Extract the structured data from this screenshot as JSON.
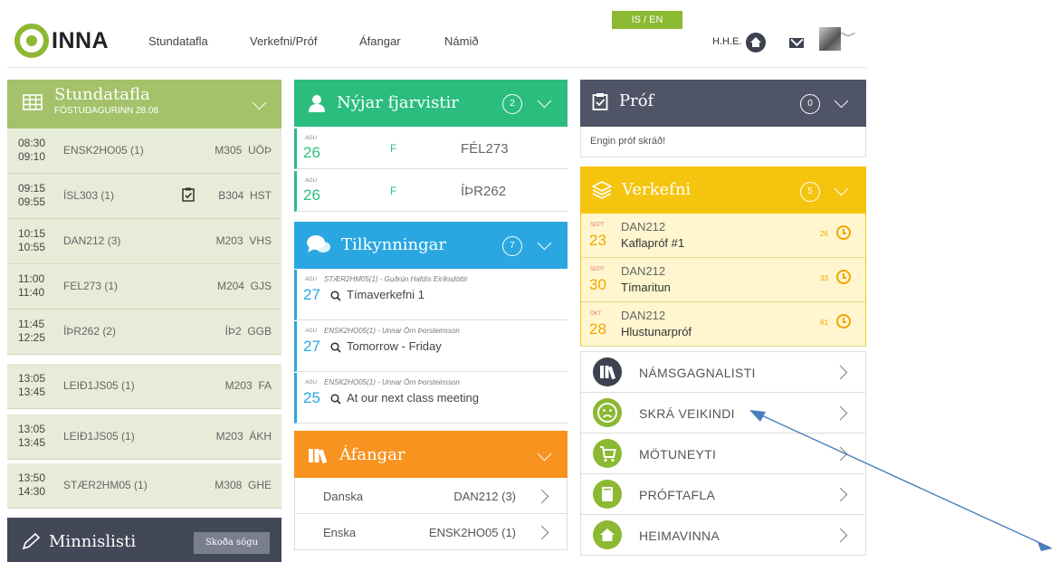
{
  "brand": {
    "logo_text": "INNA",
    "accent": "#8cb832"
  },
  "nav": {
    "items": [
      "Stundatafla",
      "Verkefni/Próf",
      "Áfangar",
      "Námið"
    ]
  },
  "header": {
    "language_toggle": "IS / EN",
    "user_initials": "H.H.E."
  },
  "schedule": {
    "title": "Stundatafla",
    "subtitle": "FÖSTUDAGURINN 28.08",
    "rows": [
      {
        "start": "08:30",
        "end": "09:10",
        "course": "ENSK2HO05 (1)",
        "room": "M305",
        "teacher": "UÖÞ"
      },
      {
        "start": "09:15",
        "end": "09:55",
        "course": "ÍSL303 (1)",
        "room": "B304",
        "teacher": "HST"
      },
      {
        "start": "10:15",
        "end": "10:55",
        "course": "DAN212 (3)",
        "room": "M203",
        "teacher": "VHS"
      },
      {
        "start": "11:00",
        "end": "11:40",
        "course": "FEL273 (1)",
        "room": "M204",
        "teacher": "GJS"
      },
      {
        "start": "11:45",
        "end": "12:25",
        "course": "ÍÞR262 (2)",
        "room": "ÍÞ2",
        "teacher": "GGB"
      },
      {
        "start": "13:05",
        "end": "13:45",
        "course": "LEIÐ1JS05 (1)",
        "room": "M203",
        "teacher": "FA"
      },
      {
        "start": "13:05",
        "end": "13:45",
        "course": "LEIÐ1JS05 (1)",
        "room": "M203",
        "teacher": "ÁKH"
      },
      {
        "start": "13:50",
        "end": "14:30",
        "course": "STÆR2HM05 (1)",
        "room": "M308",
        "teacher": "GHE"
      }
    ]
  },
  "memo": {
    "title": "Minnislisti",
    "history_button": "Skoða sögu"
  },
  "absences": {
    "title": "Nýjar fjarvistir",
    "count": "2",
    "rows": [
      {
        "month": "AGU",
        "day": "26",
        "type": "F",
        "course": "FÉL273"
      },
      {
        "month": "AGU",
        "day": "26",
        "type": "F",
        "course": "ÍÞR262"
      }
    ]
  },
  "announcements": {
    "title": "Tilkynningar",
    "count": "7",
    "rows": [
      {
        "month": "AGU",
        "day": "27",
        "meta": "STÆR2HM05(1) - Guðrún Hafdís Eiríksdóttir",
        "title": "Tímaverkefni 1"
      },
      {
        "month": "AGU",
        "day": "27",
        "meta": "ENSK2HO05(1) - Unnar Örn Þorsteinsson",
        "title": "Tomorrow - Friday"
      },
      {
        "month": "AGU",
        "day": "25",
        "meta": "ENSK2HO05(1) - Unnar Örn Þorsteinsson",
        "title": "At our next class meeting"
      }
    ]
  },
  "courses": {
    "title": "Áfangar",
    "rows": [
      {
        "name": "Danska",
        "code": "DAN212 (3)"
      },
      {
        "name": "Enska",
        "code": "ENSK2HO05 (1)"
      }
    ]
  },
  "exams": {
    "title": "Próf",
    "count": "0",
    "empty_text": "Engin próf skráð!"
  },
  "assignments": {
    "title": "Verkefni",
    "count": "5",
    "rows": [
      {
        "month": "SEPT",
        "day": "23",
        "course": "DAN212",
        "title": "Kaflapróf #1",
        "days_left": "26"
      },
      {
        "month": "SEPT",
        "day": "30",
        "course": "DAN212",
        "title": "Tímaritun",
        "days_left": "33"
      },
      {
        "month": "OKT",
        "day": "28",
        "course": "DAN212",
        "title": "Hlustunarpróf",
        "days_left": "61"
      }
    ]
  },
  "quick_links": [
    {
      "label": "NÁMSGAGNALISTI",
      "icon": "books-icon"
    },
    {
      "label": "SKRÁ VEIKINDI",
      "icon": "sad-face-icon"
    },
    {
      "label": "MÖTUNEYTI",
      "icon": "cart-icon"
    },
    {
      "label": "PRÓFTAFLA",
      "icon": "book-icon"
    },
    {
      "label": "HEIMAVINNA",
      "icon": "home-icon"
    }
  ],
  "colors": {
    "schedule": "#a3c26a",
    "absences": "#2bbd7e",
    "announcements": "#2aa7e0",
    "courses": "#f7931e",
    "exams": "#4f5566",
    "assignments": "#f5c40f",
    "link_icons": "#8cb832",
    "arrow": "#4a7ebb"
  }
}
